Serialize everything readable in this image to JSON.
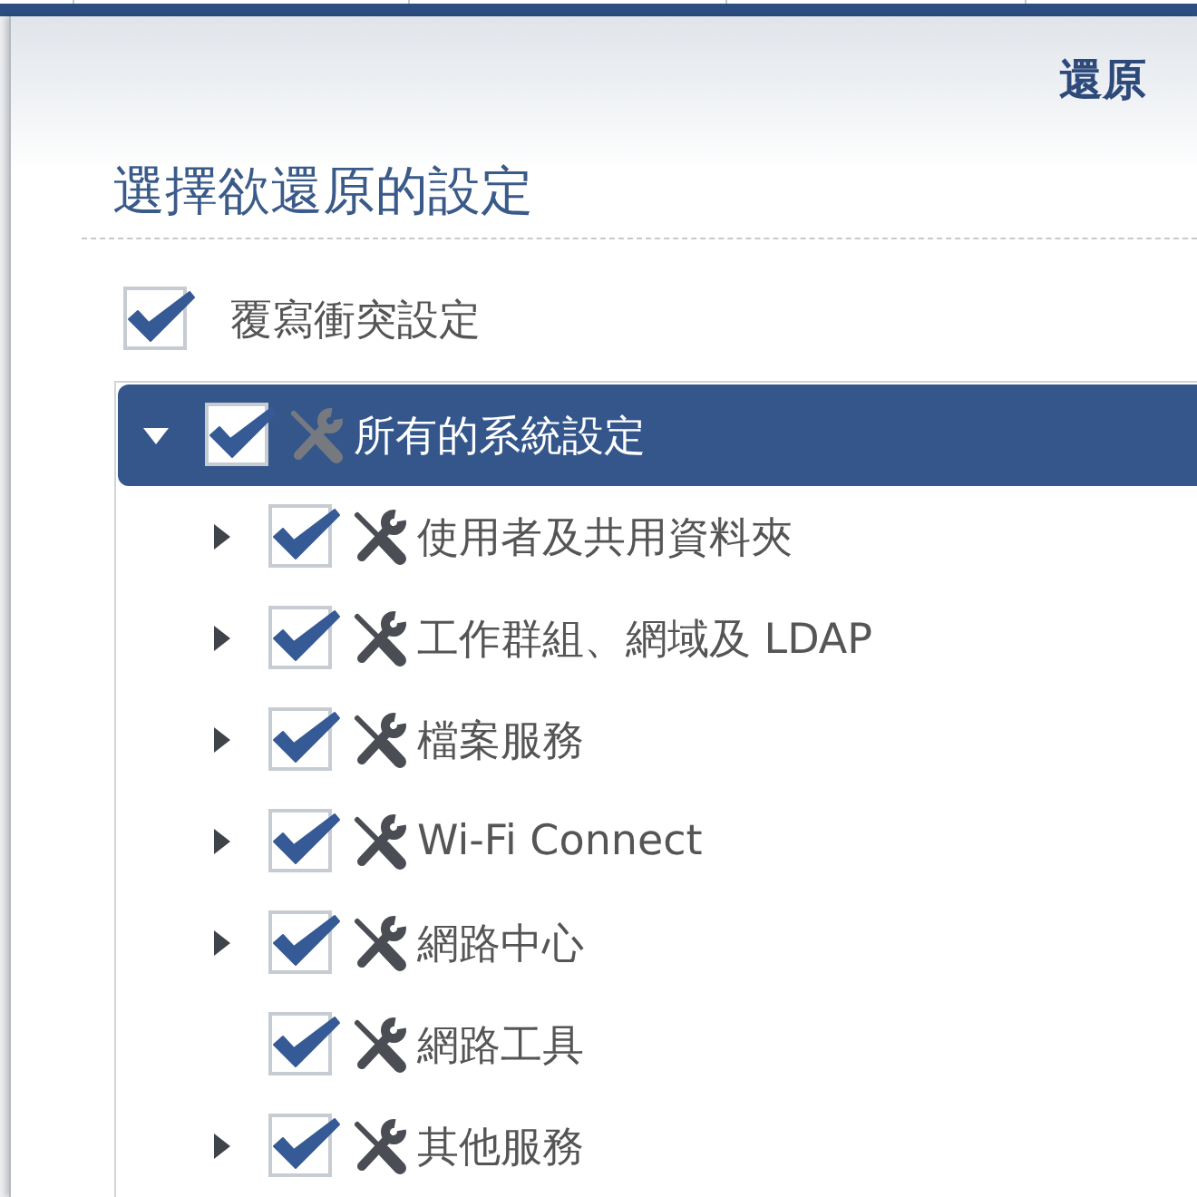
{
  "window": {
    "title": "還原"
  },
  "section": {
    "heading": "選擇欲還原的設定"
  },
  "overwrite_option": {
    "label": "覆寫衝突設定",
    "checked": true
  },
  "tree": {
    "items": [
      {
        "label": "所有的系統設定",
        "checked": true,
        "selected": true,
        "expandable": true,
        "expanded": true,
        "children": [
          {
            "label": "使用者及共用資料夾",
            "checked": true,
            "selected": false,
            "expandable": true
          },
          {
            "label": "工作群組、網域及 LDAP",
            "checked": true,
            "selected": false,
            "expandable": true
          },
          {
            "label": "檔案服務",
            "checked": true,
            "selected": false,
            "expandable": true
          },
          {
            "label": "Wi-Fi Connect",
            "checked": true,
            "selected": false,
            "expandable": true
          },
          {
            "label": "網路中心",
            "checked": true,
            "selected": false,
            "expandable": true
          },
          {
            "label": "網路工具",
            "checked": true,
            "selected": false,
            "expandable": false
          },
          {
            "label": "其他服務",
            "checked": true,
            "selected": false,
            "expandable": true
          }
        ]
      }
    ]
  }
}
